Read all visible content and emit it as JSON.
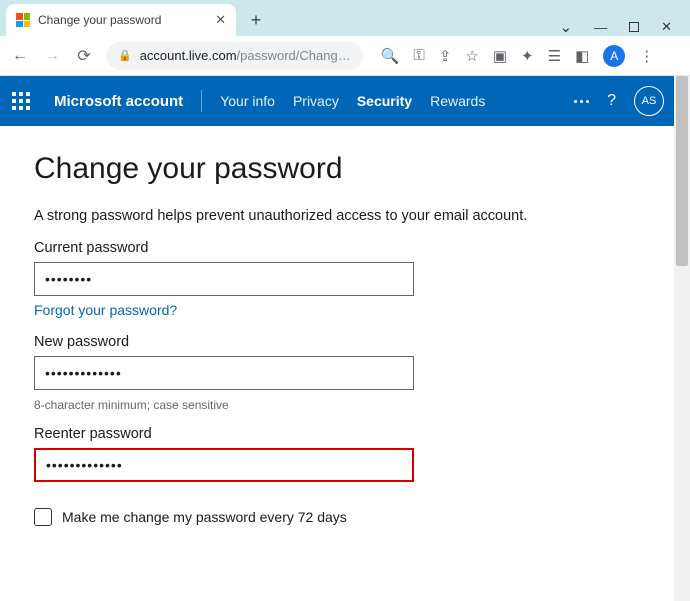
{
  "browser": {
    "tab_title": "Change your password",
    "url_host": "account.live.com",
    "url_path": "/password/Chang…",
    "avatar_letter": "A"
  },
  "header": {
    "brand": "Microsoft account",
    "nav": [
      "Your info",
      "Privacy",
      "Security",
      "Rewards"
    ],
    "active_index": 2,
    "avatar_initials": "AS"
  },
  "page": {
    "title": "Change your password",
    "lead": "A strong password helps prevent unauthorized access to your email account.",
    "current_label": "Current password",
    "current_value": "••••••••",
    "forgot_link": "Forgot your password?",
    "new_label": "New password",
    "new_value": "•••••••••••••",
    "hint": "8-character minimum; case sensitive",
    "reenter_label": "Reenter password",
    "reenter_value": "•••••••••••••",
    "checkbox_label": "Make me change my password every 72 days"
  }
}
